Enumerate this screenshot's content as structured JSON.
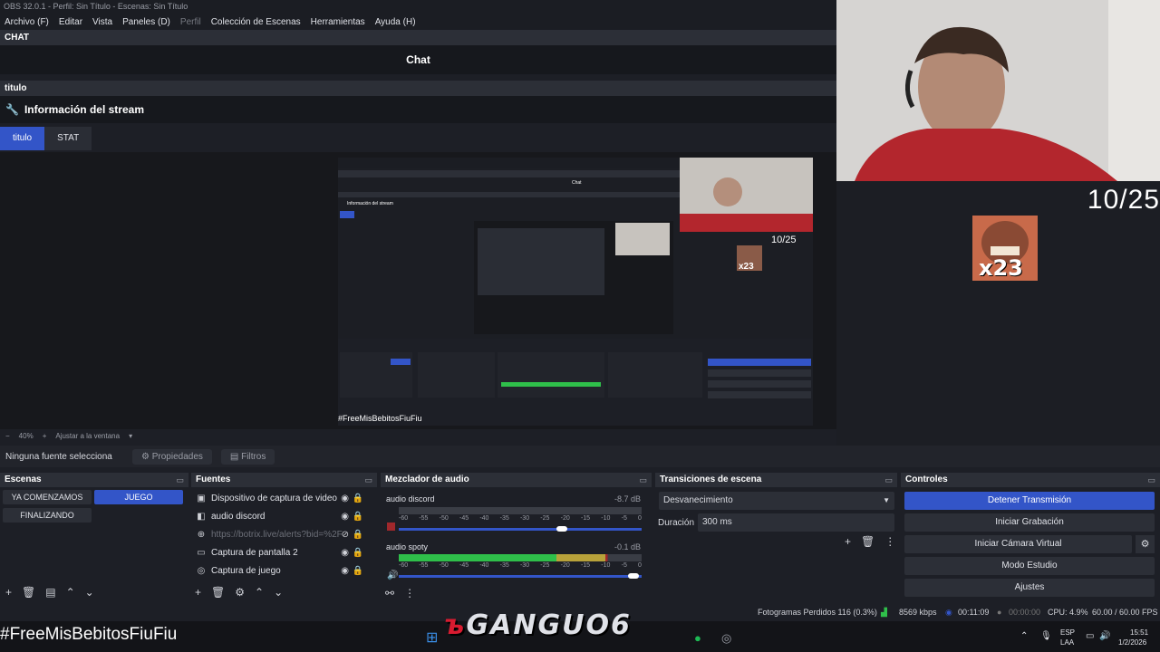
{
  "window": {
    "title": "OBS 32.0.1 - Perfil: Sin Título - Escenas: Sin Título"
  },
  "menu": [
    {
      "label": "Archivo (F)"
    },
    {
      "label": "Editar"
    },
    {
      "label": "Vista"
    },
    {
      "label": "Paneles (D)"
    },
    {
      "label": "Perfil",
      "disabled": true
    },
    {
      "label": "Colección de Escenas"
    },
    {
      "label": "Herramientas"
    },
    {
      "label": "Ayuda (H)"
    }
  ],
  "chat_dock": {
    "header": "CHAT",
    "title": "Chat"
  },
  "titulo_dock": {
    "header": "titulo",
    "info": "Información del stream"
  },
  "tabs": [
    {
      "label": "titulo",
      "active": true
    },
    {
      "label": "STAT",
      "active": false
    }
  ],
  "zoom": {
    "value": "40%",
    "fit": "Ajustar a la ventana"
  },
  "overlay": {
    "score": "10/25",
    "multiplier": "x23",
    "hashtag": "#FreeMisBebitosFiuFiu",
    "brand": "GANGUO6"
  },
  "source_bar": {
    "none_selected": "Ninguna fuente selecciona",
    "properties": "Propiedades",
    "filters": "Filtros"
  },
  "scenes": {
    "header": "Escenas",
    "items": [
      {
        "label": "YA COMENZAMOS",
        "active": false
      },
      {
        "label": "JUEGO",
        "active": true
      },
      {
        "label": "FINALIZANDO",
        "active": false
      }
    ]
  },
  "sources": {
    "header": "Fuentes",
    "items": [
      {
        "label": "Dispositivo de captura de video",
        "icon": "camera-icon"
      },
      {
        "label": "audio discord",
        "icon": "speaker-icon"
      },
      {
        "label": "https://botrix.live/alerts?bid=%2FV",
        "icon": "globe-icon",
        "hidden": true
      },
      {
        "label": "Captura de pantalla 2",
        "icon": "monitor-icon"
      },
      {
        "label": "Captura de juego",
        "icon": "gamepad-icon"
      }
    ]
  },
  "mixer": {
    "header": "Mezclador de audio",
    "channels": [
      {
        "name": "audio discord",
        "db": "-8.7 dB",
        "level": 0.0,
        "volume": 0.68
      },
      {
        "name": "audio spoty",
        "db": "-0.1 dB",
        "level": 0.86,
        "volume": 1.0
      }
    ],
    "scale": [
      "-60",
      "-55",
      "-50",
      "-45",
      "-40",
      "-35",
      "-30",
      "-25",
      "-20",
      "-15",
      "-10",
      "-5",
      "0"
    ]
  },
  "transitions": {
    "header": "Transiciones de escena",
    "selected": "Desvanecimiento",
    "duration_label": "Duración",
    "duration_value": "300 ms"
  },
  "controls": {
    "header": "Controles",
    "buttons": [
      {
        "label": "Detener Transmisión",
        "primary": true
      },
      {
        "label": "Iniciar Grabación"
      },
      {
        "label": "Iniciar Cámara Virtual"
      },
      {
        "label": "Modo Estudio"
      },
      {
        "label": "Ajustes"
      }
    ]
  },
  "status": {
    "dropped": "Fotogramas Perdidos 116 (0.3%)",
    "bitrate": "8569 kbps",
    "stream_time": "00:11:09",
    "rec_time": "00:00:00",
    "cpu": "CPU: 4.9%",
    "fps": "60.00 / 60.00 FPS"
  },
  "tray": {
    "lang1": "ESP",
    "lang2": "LAA",
    "time": "15:51",
    "date": "1/2/2026"
  },
  "colors": {
    "accent": "#3355c8",
    "panel": "#1d1f26",
    "header": "#2c2f37",
    "meter_green": "#2fbf4a",
    "meter_yellow": "#b8a23a",
    "meter_red": "#a0282c"
  }
}
